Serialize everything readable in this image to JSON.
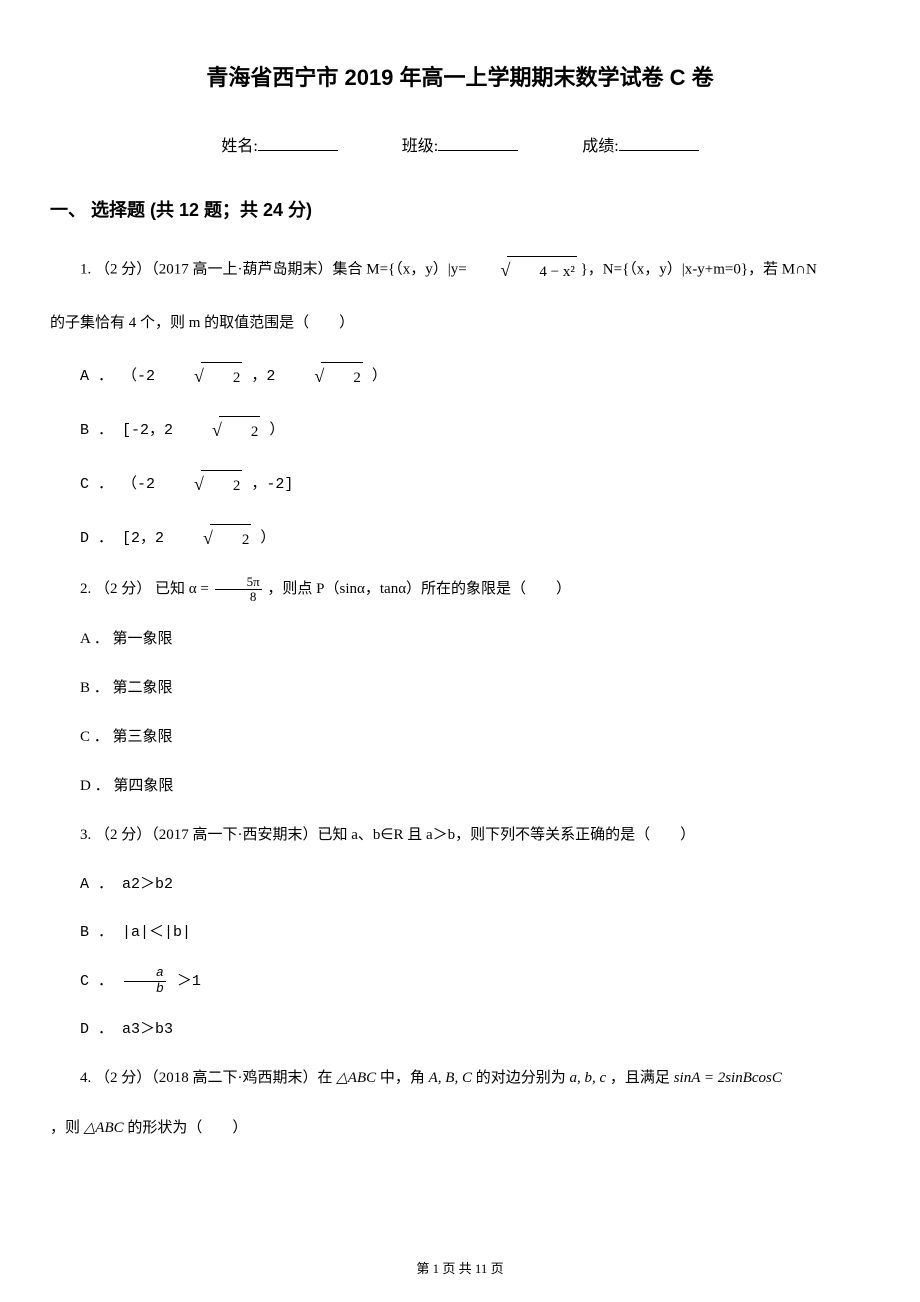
{
  "title": "青海省西宁市 2019 年高一上学期期末数学试卷 C 卷",
  "info": {
    "name_label": "姓名:",
    "class_label": "班级:",
    "score_label": "成绩:"
  },
  "section": "一、 选择题 (共 12 题；共 24 分)",
  "q1": {
    "stem_a": "1. （2 分）（2017 高一上·葫芦岛期末）集合 M={（x，y）|y= ",
    "radicand": "4 − x²",
    "stem_b": " }，N={（x，y）|x‑y+m=0}，若 M∩N",
    "stem_c": "的子集恰有 4 个，则 m 的取值范围是（　　）",
    "A_a": "A ． （‑2 ",
    "A_r": "2",
    "A_b": " ，2 ",
    "A_r2": "2",
    "A_c": " ）",
    "B_a": "B ． [‑2，2 ",
    "B_r": "2",
    "B_b": " ）",
    "C_a": "C ． （‑2 ",
    "C_r": "2",
    "C_b": " ，‑2]",
    "D_a": "D ． [2，2 ",
    "D_r": "2",
    "D_b": " ）"
  },
  "q2": {
    "stem_a": "2. （2 分） 已知 α = ",
    "num": "5π",
    "den": "8",
    "stem_b": " ，则点 P（sinα，tanα）所在的象限是（　　）",
    "A": "A ． 第一象限",
    "B": "B ． 第二象限",
    "C": "C ． 第三象限",
    "D": "D ． 第四象限"
  },
  "q3": {
    "stem": "3. （2 分）（2017 高一下·西安期末）已知 a、b∈R 且 a＞b，则下列不等关系正确的是（　　）",
    "A": "A ． a2＞b2",
    "B": "B ． |a|＜|b|",
    "C_a": "C ． ",
    "C_num": "a",
    "C_den": "b",
    "C_b": " ＞1",
    "D": "D ． a3＞b3"
  },
  "q4": {
    "stem_a": "4. （2 分）（2018 高二下·鸡西期末）在 ",
    "tri1": "△ABC",
    "stem_b": " 中，角 ",
    "abc1": "A, B, C",
    "stem_c": " 的对边分别为 ",
    "abc2": "a, b, c",
    "stem_d": " ，且满足 ",
    "eq": "sinA = 2sinBcosC",
    "stem_e": "，则 ",
    "tri2": "△ABC",
    "stem_f": " 的形状为（　　）"
  },
  "pager": "第 1 页 共 11 页"
}
